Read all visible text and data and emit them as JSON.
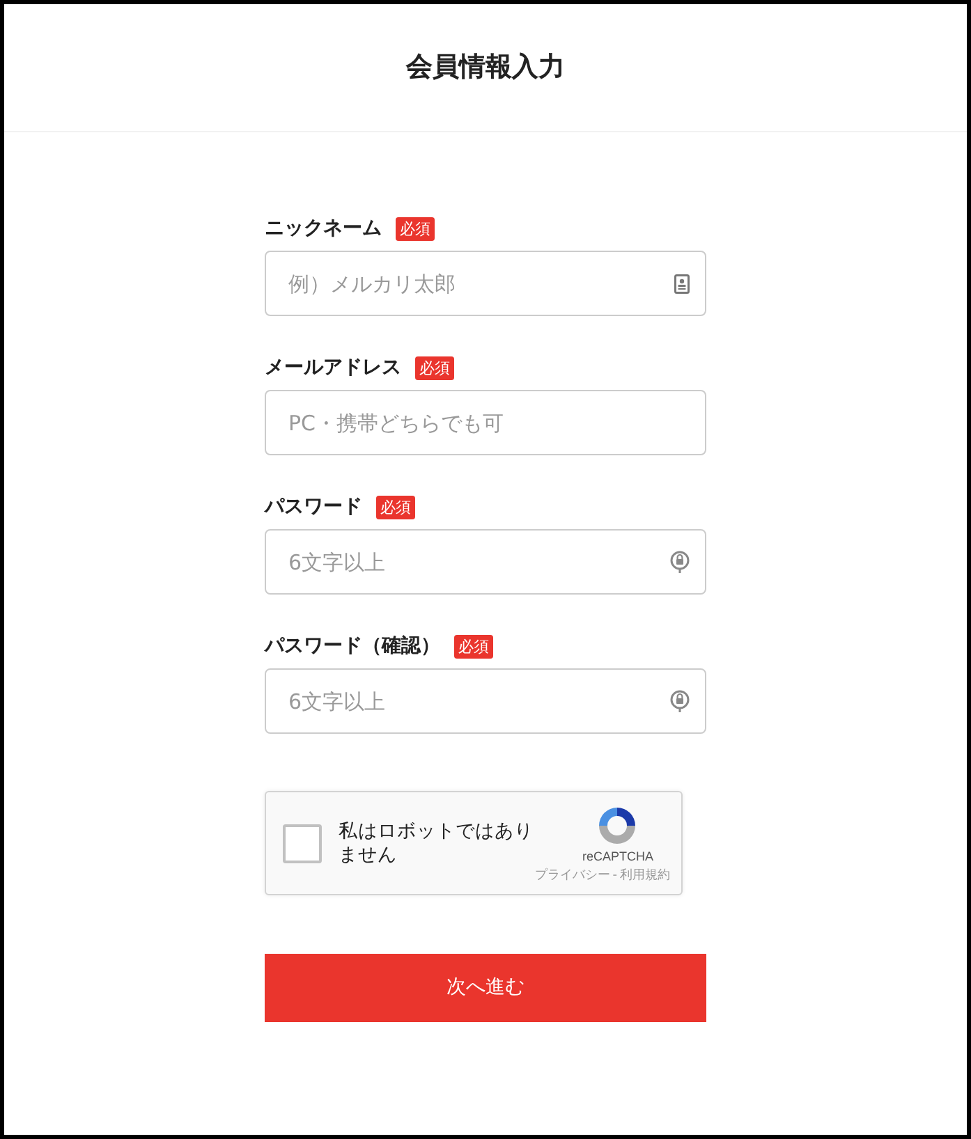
{
  "header": {
    "title": "会員情報入力"
  },
  "fields": [
    {
      "kind": "name",
      "label": "ニックネーム",
      "required_badge": "必須",
      "placeholder": "例）メルカリ太郎"
    },
    {
      "kind": "email",
      "label": "メールアドレス",
      "required_badge": "必須",
      "placeholder": "PC・携帯どちらでも可"
    },
    {
      "kind": "password",
      "label": "パスワード",
      "required_badge": "必須",
      "placeholder": "6文字以上"
    },
    {
      "kind": "password",
      "label": "パスワード（確認）",
      "required_badge": "必須",
      "placeholder": "6文字以上"
    }
  ],
  "captcha": {
    "checked": false,
    "label": "私はロボットではありません",
    "brand": "reCAPTCHA",
    "privacy_link": "プライバシー",
    "separator": "-",
    "terms_link": "利用規約"
  },
  "submit_button": "次へ進む"
}
